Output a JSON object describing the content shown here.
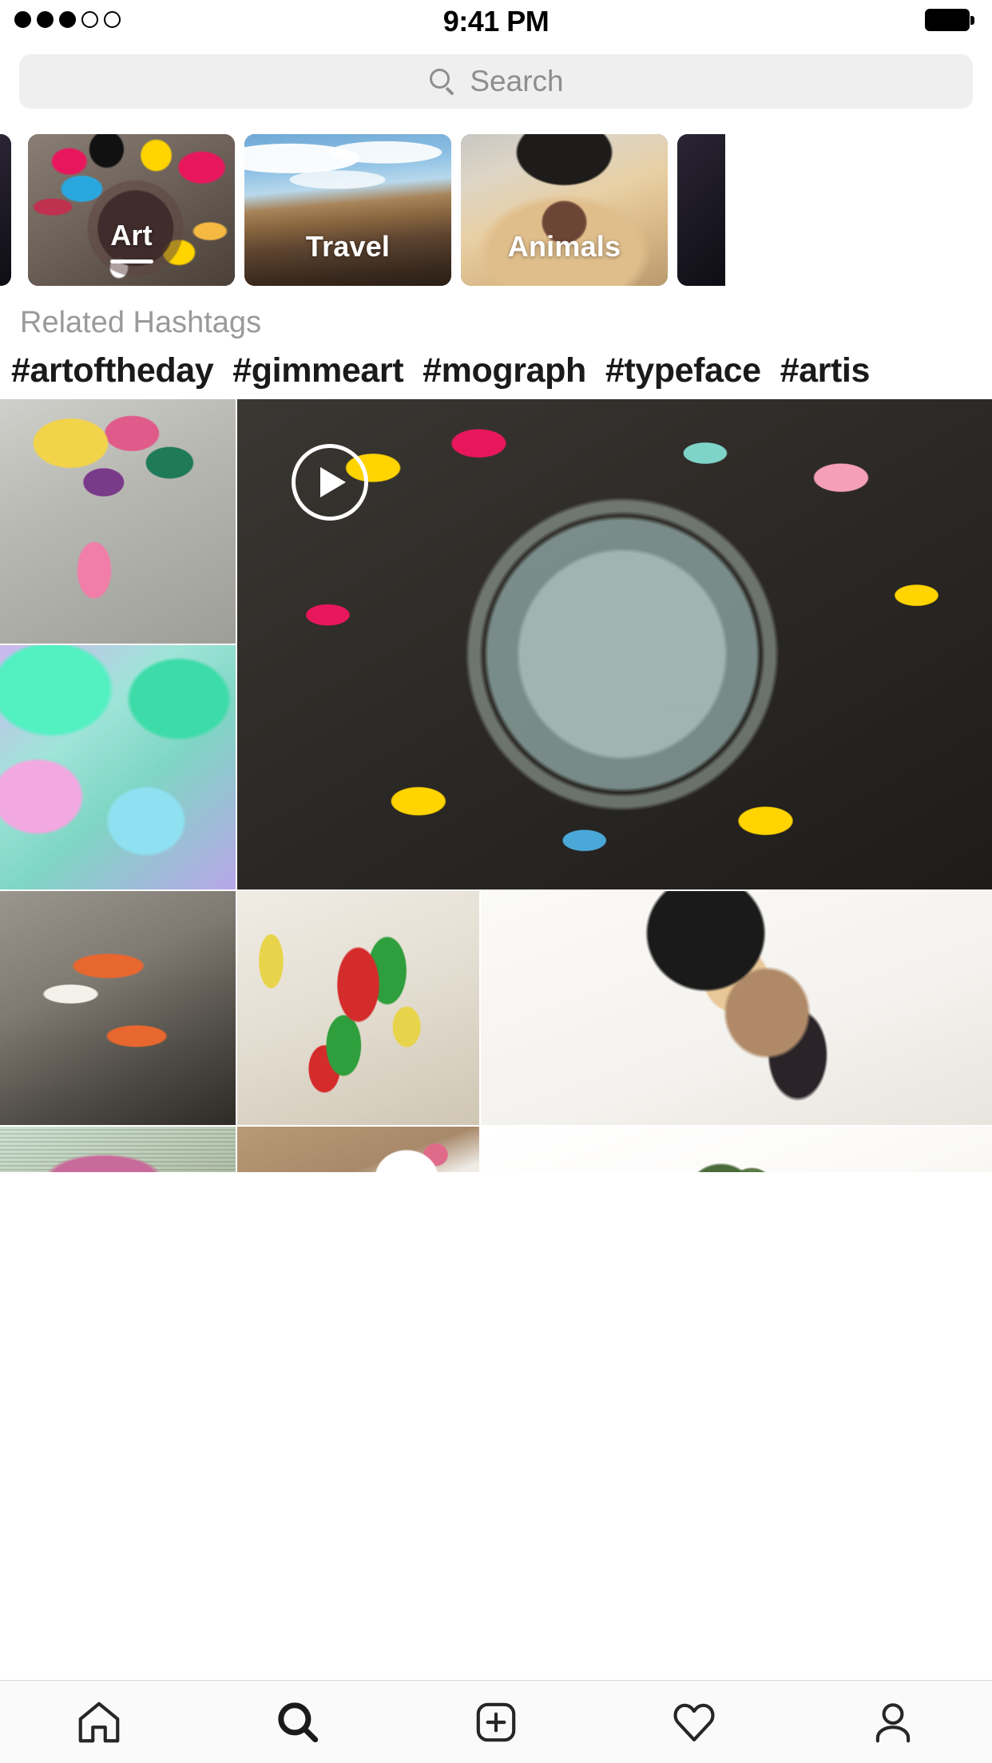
{
  "status_bar": {
    "signal_dots": {
      "filled": 3,
      "empty": 2
    },
    "time": "9:41 PM",
    "battery_icon": "battery-full-icon"
  },
  "search": {
    "placeholder": "Search",
    "value": "",
    "icon": "search-icon"
  },
  "categories": {
    "items": [
      {
        "label": "",
        "active": false,
        "partial": "left",
        "theme": "dark"
      },
      {
        "label": "Art",
        "active": true,
        "partial": "none",
        "theme": "art"
      },
      {
        "label": "Travel",
        "active": false,
        "partial": "none",
        "theme": "travel"
      },
      {
        "label": "Animals",
        "active": false,
        "partial": "none",
        "theme": "animals"
      },
      {
        "label": "",
        "active": false,
        "partial": "right",
        "theme": "dark"
      }
    ]
  },
  "related_hashtags": {
    "title": "Related Hashtags",
    "tags": [
      "#artoftheday",
      "#gimmeart",
      "#mograph",
      "#typeface",
      "#artis"
    ]
  },
  "grid": {
    "tiles": [
      {
        "name": "post-sketchbook",
        "type": "photo"
      },
      {
        "name": "post-cyberart",
        "type": "photo"
      },
      {
        "name": "post-paint-video",
        "type": "video",
        "overlay": "play-icon"
      },
      {
        "name": "post-koi-fish",
        "type": "photo"
      },
      {
        "name": "post-painted-blocks",
        "type": "photo"
      },
      {
        "name": "post-portrait",
        "type": "photo"
      },
      {
        "name": "post-glitch",
        "type": "photo"
      },
      {
        "name": "post-paper",
        "type": "photo"
      },
      {
        "name": "post-greenbrush",
        "type": "photo"
      }
    ]
  },
  "tab_bar": {
    "items": [
      {
        "icon": "home-icon",
        "label": "Home",
        "active": false
      },
      {
        "icon": "search-icon",
        "label": "Search",
        "active": true
      },
      {
        "icon": "plus-box-icon",
        "label": "Create",
        "active": false
      },
      {
        "icon": "heart-icon",
        "label": "Activity",
        "active": false
      },
      {
        "icon": "person-icon",
        "label": "Profile",
        "active": false
      }
    ]
  },
  "colors": {
    "background": "#ffffff",
    "search_field": "#efefef",
    "placeholder_text": "#8e8e8e",
    "muted_text": "#9a9a9a",
    "primary_text": "#1a1a1a",
    "tabbar_background": "#fafafa",
    "tabbar_border": "#dbdbdb",
    "icon_active": "#1a1a1a",
    "icon_inactive": "#262626"
  }
}
